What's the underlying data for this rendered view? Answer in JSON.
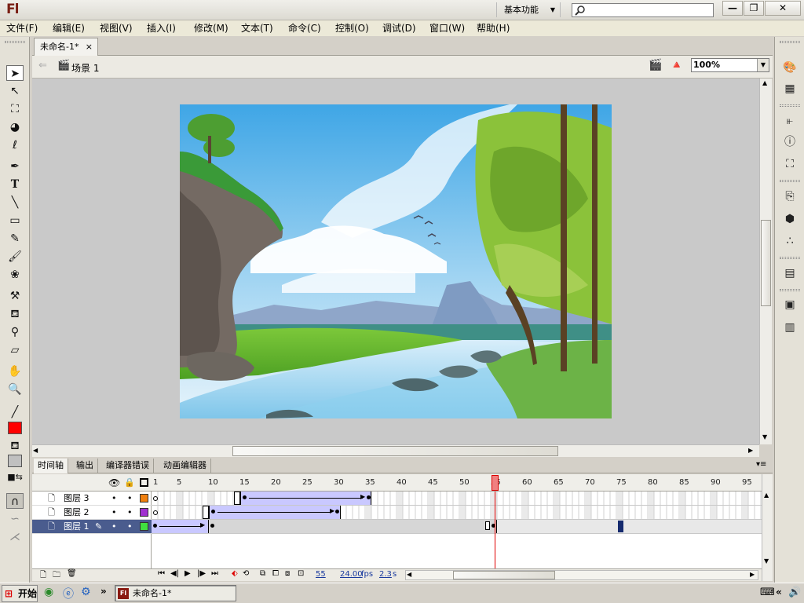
{
  "app": {
    "logo": "Fl",
    "workspace": "基本功能",
    "search_placeholder": ""
  },
  "window_controls": {
    "minimize": "—",
    "restore": "❐",
    "close": "✕"
  },
  "menu": [
    "文件(F)",
    "编辑(E)",
    "视图(V)",
    "插入(I)",
    "修改(M)",
    "文本(T)",
    "命令(C)",
    "控制(O)",
    "调试(D)",
    "窗口(W)",
    "帮助(H)"
  ],
  "document": {
    "tab": "未命名-1*",
    "close": "×",
    "scene": "场景 1",
    "zoom": "100%"
  },
  "timeline": {
    "tabs": [
      "时间轴",
      "输出",
      "编译器错误",
      "动画编辑器"
    ],
    "ruler": [
      "1",
      "5",
      "10",
      "15",
      "20",
      "25",
      "30",
      "35",
      "40",
      "45",
      "50",
      "55",
      "60",
      "65",
      "70",
      "75",
      "80",
      "85",
      "90",
      "95"
    ],
    "layers": [
      {
        "name": "图层 3",
        "color": "#f08010"
      },
      {
        "name": "图层 2",
        "color": "#a030d0"
      },
      {
        "name": "图层 1",
        "color": "#40e040"
      }
    ],
    "status": {
      "current_frame": "55",
      "fps": "24.00",
      "fps_unit": "fps",
      "time": "2.3",
      "time_unit": "s"
    }
  },
  "taskbar": {
    "start": "开始",
    "task": "未命名-1*",
    "chevron": "»",
    "tray_chevron": "«"
  }
}
